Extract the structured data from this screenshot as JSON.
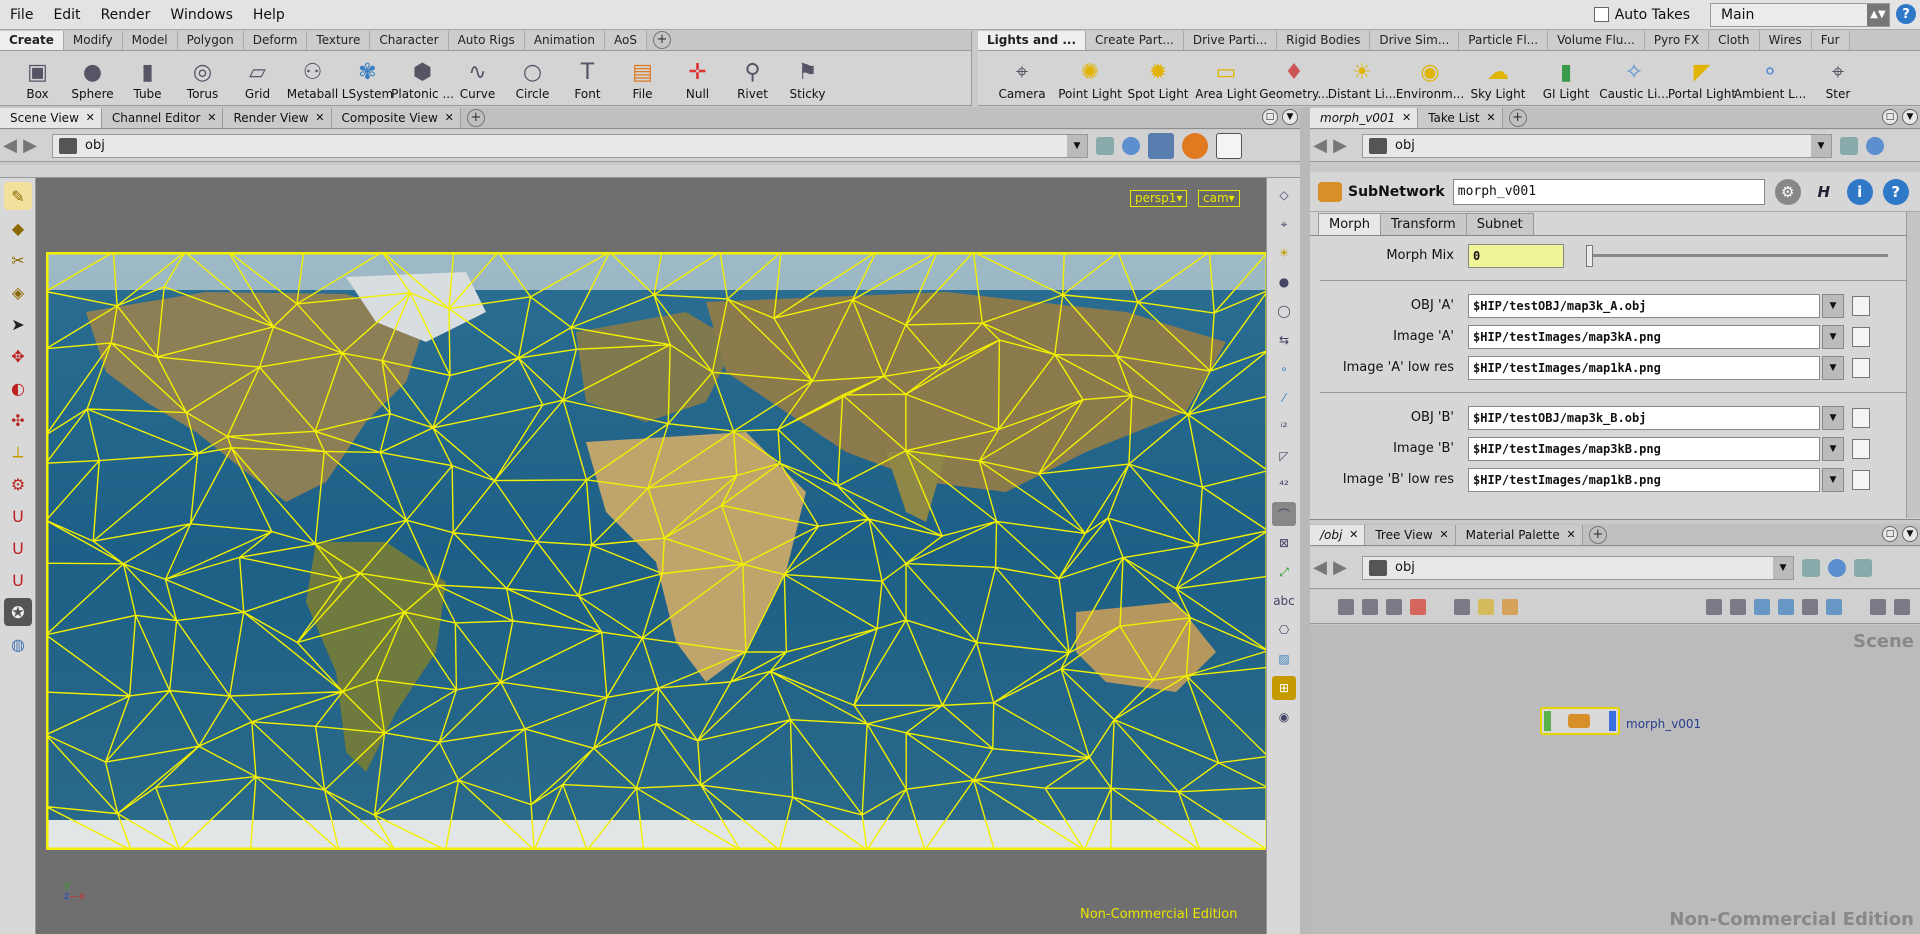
{
  "menubar": {
    "items": [
      "File",
      "Edit",
      "Render",
      "Windows",
      "Help"
    ],
    "auto_takes": "Auto Takes",
    "desktop": "Main"
  },
  "shelf_left": {
    "tabs": [
      "Create",
      "Modify",
      "Model",
      "Polygon",
      "Deform",
      "Texture",
      "Character",
      "Auto Rigs",
      "Animation",
      "AoS"
    ],
    "tools": [
      "Box",
      "Sphere",
      "Tube",
      "Torus",
      "Grid",
      "Metaball",
      "LSystem",
      "Platonic ...",
      "Curve",
      "Circle",
      "Font",
      "File",
      "Null",
      "Rivet",
      "Sticky"
    ]
  },
  "shelf_right": {
    "tabs": [
      "Lights and ...",
      "Create Part...",
      "Drive Parti...",
      "Rigid Bodies",
      "Drive Sim...",
      "Particle Fl...",
      "Volume Flu...",
      "Pyro FX",
      "Cloth",
      "Wires",
      "Fur"
    ],
    "tools": [
      "Camera",
      "Point Light",
      "Spot Light",
      "Area Light",
      "Geometry...",
      "Distant Li...",
      "Environm...",
      "Sky Light",
      "GI Light",
      "Caustic Li...",
      "Portal Light",
      "Ambient L...",
      "Ster"
    ]
  },
  "scene_pane": {
    "tabs": [
      "Scene View",
      "Channel Editor",
      "Render View",
      "Composite View"
    ],
    "path": "obj",
    "persp": "persp1▾",
    "cam": "cam▾",
    "watermark": "Non-Commercial Edition"
  },
  "param_pane": {
    "tabs": [
      "morph_v001",
      "Take List"
    ],
    "path": "obj",
    "node_type": "SubNetwork",
    "node_name": "morph_v001",
    "param_tabs": [
      "Morph",
      "Transform",
      "Subnet"
    ],
    "morph_mix_label": "Morph Mix",
    "morph_mix_value": "0",
    "params_a": [
      {
        "label": "OBJ 'A'",
        "value": "$HIP/testOBJ/map3k_A.obj"
      },
      {
        "label": "Image 'A'",
        "value": "$HIP/testImages/map3kA.png"
      },
      {
        "label": "Image 'A' low res",
        "value": "$HIP/testImages/map1kA.png"
      }
    ],
    "params_b": [
      {
        "label": "OBJ 'B'",
        "value": "$HIP/testOBJ/map3k_B.obj"
      },
      {
        "label": "Image 'B'",
        "value": "$HIP/testImages/map3kB.png"
      },
      {
        "label": "Image 'B' low res",
        "value": "$HIP/testImages/map1kB.png"
      }
    ]
  },
  "network_pane": {
    "tabs": [
      "/obj",
      "Tree View",
      "Material Palette"
    ],
    "path": "obj",
    "scene_label": "Scene",
    "node_label": "morph_v001",
    "watermark": "Non-Commercial Edition"
  },
  "colors": {
    "wire": "#f2f000",
    "ocean": "#1d5f86",
    "land": "#a08a5a"
  }
}
